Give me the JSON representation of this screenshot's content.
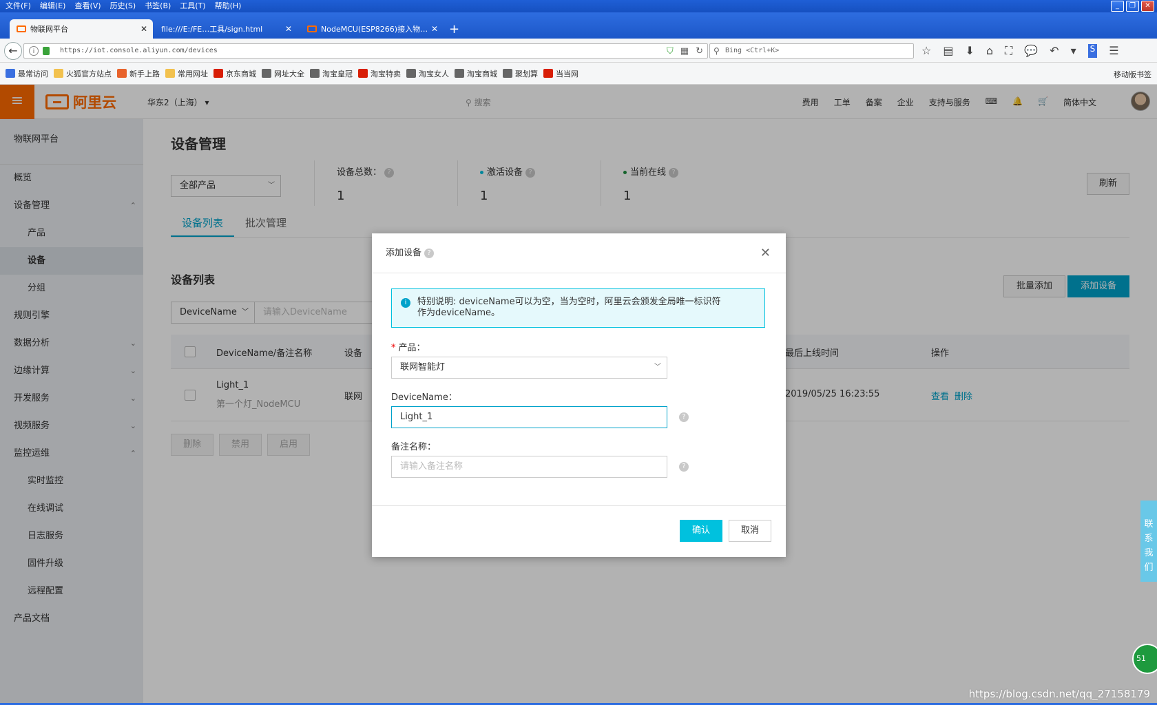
{
  "browser": {
    "menu": [
      "文件(F)",
      "编辑(E)",
      "查看(V)",
      "历史(S)",
      "书签(B)",
      "工具(T)",
      "帮助(H)"
    ],
    "tabs": [
      {
        "label": "物联网平台",
        "active": true
      },
      {
        "label": "file:///E:/FE…工具/sign.html",
        "active": false
      },
      {
        "label": "NodeMCU(ESP8266)接入物…",
        "active": false
      }
    ],
    "url": "https://iot.console.aliyun.com/devices",
    "search_placeholder": "Bing <Ctrl+K>",
    "bookmarks": [
      "最常访问",
      "火狐官方站点",
      "新手上路",
      "常用网址",
      "京东商城",
      "网址大全",
      "淘宝皇冠",
      "淘宝特卖",
      "淘宝女人",
      "淘宝商城",
      "聚划算",
      "当当网"
    ],
    "mobile_bookmarks": "移动版书签"
  },
  "header": {
    "logo": "阿里云",
    "region": "华东2（上海）",
    "search_placeholder": "搜索",
    "menu": [
      "费用",
      "工单",
      "备案",
      "企业",
      "支持与服务"
    ],
    "language": "简体中文"
  },
  "sidebar": {
    "title": "物联网平台",
    "items": [
      {
        "label": "概览",
        "sub": false
      },
      {
        "label": "设备管理",
        "sub": false,
        "chev": "⌃"
      },
      {
        "label": "产品",
        "sub": true
      },
      {
        "label": "设备",
        "sub": true,
        "active": true
      },
      {
        "label": "分组",
        "sub": true
      },
      {
        "label": "规则引擎",
        "sub": false
      },
      {
        "label": "数据分析",
        "sub": false,
        "chev": "⌄"
      },
      {
        "label": "边缘计算",
        "sub": false,
        "chev": "⌄"
      },
      {
        "label": "开发服务",
        "sub": false,
        "chev": "⌄"
      },
      {
        "label": "视频服务",
        "sub": false,
        "chev": "⌄"
      },
      {
        "label": "监控运维",
        "sub": false,
        "chev": "⌃"
      },
      {
        "label": "实时监控",
        "sub": true
      },
      {
        "label": "在线调试",
        "sub": true
      },
      {
        "label": "日志服务",
        "sub": true
      },
      {
        "label": "固件升级",
        "sub": true
      },
      {
        "label": "远程配置",
        "sub": true
      },
      {
        "label": "产品文档",
        "sub": false
      }
    ]
  },
  "main": {
    "title": "设备管理",
    "product_filter": "全部产品",
    "stats": {
      "total_label": "设备总数：",
      "total": "1",
      "active_label": "激活设备",
      "active": "1",
      "online_label": "当前在线",
      "online": "1"
    },
    "refresh": "刷新",
    "tabs": [
      "设备列表",
      "批次管理"
    ],
    "list_title": "设备列表",
    "filter_field": "DeviceName",
    "filter_placeholder": "请输入DeviceName",
    "bulk_add": "批量添加",
    "add_device": "添加设备",
    "columns": {
      "name": "DeviceName/备注名称",
      "product": "设备",
      "last_online": "最后上线时间",
      "ops": "操作"
    },
    "row": {
      "name": "Light_1",
      "note": "第一个灯_NodeMCU",
      "product": "联网",
      "last_online": "2019/05/25 16:23:55",
      "view": "查看",
      "delete": "删除"
    },
    "footer_buttons": [
      "删除",
      "禁用",
      "启用"
    ]
  },
  "dialog": {
    "title": "添加设备",
    "notice_line1": "特别说明: deviceName可以为空，当为空时，阿里云会颁发全局唯一标识符",
    "notice_line2": "作为deviceName。",
    "product_label": "产品：",
    "product_value": "联网智能灯",
    "devicename_label": "DeviceName：",
    "devicename_value": "Light_1",
    "note_label": "备注名称：",
    "note_placeholder": "请输入备注名称",
    "ok": "确认",
    "cancel": "取消"
  },
  "contact": "联系我们",
  "badge": "51",
  "watermark": "https://blog.csdn.net/qq_27158179",
  "colors": {
    "brand": "#ff6a00",
    "accent": "#00a2ca",
    "confirm": "#00c1de"
  }
}
